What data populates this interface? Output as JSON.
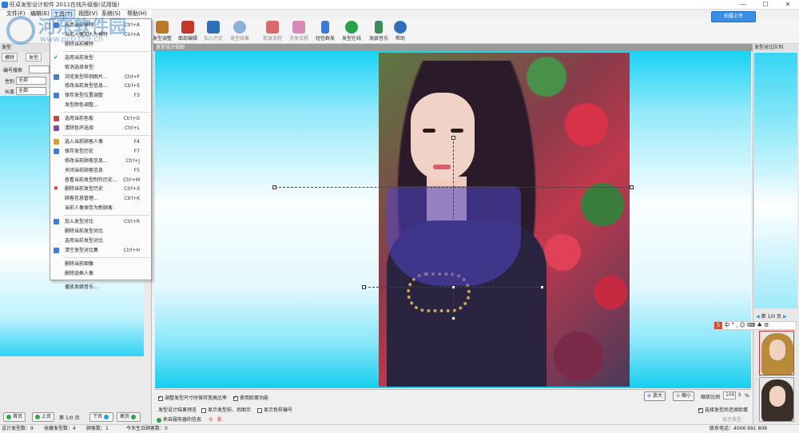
{
  "window": {
    "title": "旺卓发型设计软件 2011在线升级版(试用版)",
    "buttons": {
      "minimize": "—",
      "maximize": "☐",
      "close": "✕"
    }
  },
  "menubar": {
    "items": [
      "文件(F)",
      "编辑(E)",
      "工具(T)",
      "视图(V)",
      "系统(S)",
      "帮助(H)"
    ]
  },
  "toolbar": {
    "items": [
      {
        "label": "发型调整",
        "icon": "hair-adjust-icon",
        "dim": false
      },
      {
        "label": "面部编辑",
        "icon": "face-edit-icon",
        "dim": false
      },
      {
        "label": "加入历史",
        "icon": "add-history-icon",
        "dim": true
      },
      {
        "label": "发型结果",
        "icon": "hair-result-icon",
        "dim": true
      },
      {
        "label": "剪发流程",
        "icon": "cut-flow-icon",
        "dim": true
      },
      {
        "label": "烫发流程",
        "icon": "perm-flow-icon",
        "dim": true
      },
      {
        "label": "短信群发",
        "icon": "sms-icon",
        "dim": false
      },
      {
        "label": "发型在线",
        "icon": "hair-online-icon",
        "dim": false
      },
      {
        "label": "发廊音乐",
        "icon": "music-icon",
        "dim": false
      },
      {
        "label": "帮助",
        "icon": "help-icon",
        "dim": false
      }
    ],
    "upload_label": "拍摄上传"
  },
  "left_panel": {
    "header": "发型",
    "tabs": [
      "模特",
      "发型"
    ],
    "search_label": "编号搜索",
    "filters": [
      {
        "label": "性别",
        "value": "全部"
      },
      {
        "label": "长度",
        "value": "全部"
      }
    ],
    "paging": {
      "first": "首页",
      "prev": "上页",
      "page": "第 1/0 页",
      "next": "下页",
      "last": "尾页"
    }
  },
  "dropdown": {
    "items": [
      {
        "label": "选用当前模特",
        "key": "Ctrl+A",
        "icon": "model-icon",
        "color": "#3d7fd6"
      },
      {
        "label": "当前人像加入为模特",
        "key": "Ctrl+A",
        "icon": "",
        "color": ""
      },
      {
        "label": "删除当前模特",
        "key": "",
        "icon": "",
        "color": ""
      },
      {
        "sep": true
      },
      {
        "label": "选用当前发型",
        "key": "",
        "icon": "check-icon",
        "color": "#2aa04a"
      },
      {
        "label": "取消选择发型",
        "key": "",
        "icon": "",
        "color": ""
      },
      {
        "label": "浏览发型样例图片...",
        "key": "Ctrl+F",
        "icon": "browse-icon",
        "color": "#3d7fd6"
      },
      {
        "label": "修改当前发型信息...",
        "key": "Ctrl+E",
        "icon": "",
        "color": ""
      },
      {
        "label": "保存发型位置调整",
        "key": "F3",
        "icon": "save-icon",
        "color": "#3d7fd6"
      },
      {
        "label": "发型颜色调整...",
        "key": "",
        "icon": "",
        "color": ""
      },
      {
        "sep": true
      },
      {
        "label": "选用当前色板",
        "key": "Ctrl+G",
        "icon": "palette-icon",
        "color": "#c44"
      },
      {
        "label": "清除色环选择",
        "key": "Ctrl+L",
        "icon": "clear-icon",
        "color": "#7a4ab8"
      },
      {
        "sep": true
      },
      {
        "label": "选入当前顾客人像",
        "key": "F4",
        "icon": "customer-icon",
        "color": "#e09a2a"
      },
      {
        "label": "保存发型历史",
        "key": "F7",
        "icon": "history-icon",
        "color": "#3d7fd6"
      },
      {
        "label": "修改当前顾客信息...",
        "key": "Ctrl+J",
        "icon": "",
        "color": ""
      },
      {
        "label": "关闭当前顾客信息",
        "key": "F5",
        "icon": "",
        "color": ""
      },
      {
        "label": "查看当前发型制作历史...",
        "key": "Ctrl+M",
        "icon": "",
        "color": ""
      },
      {
        "label": "删除当前发型历史",
        "key": "Ctrl+X",
        "icon": "delete-icon",
        "color": "#c22"
      },
      {
        "label": "顾客信息管理...",
        "key": "Ctrl+K",
        "icon": "",
        "color": ""
      },
      {
        "label": "当前人像保存为新顾客",
        "key": "",
        "icon": "",
        "color": ""
      },
      {
        "sep": true
      },
      {
        "label": "加入发型对比",
        "key": "Ctrl+R",
        "icon": "compare-icon",
        "color": "#3d7fd6"
      },
      {
        "label": "删除当前发型对比",
        "key": "",
        "icon": "",
        "color": ""
      },
      {
        "label": "选用当前发型对比",
        "key": "",
        "icon": "",
        "color": ""
      },
      {
        "label": "清空发型对比集",
        "key": "Ctrl+H",
        "icon": "clear-compare-icon",
        "color": "#3d7fd6"
      },
      {
        "sep": true
      },
      {
        "label": "删除当前图像",
        "key": "",
        "icon": "",
        "color": ""
      },
      {
        "label": "删除选框人像",
        "key": "",
        "icon": "",
        "color": ""
      },
      {
        "sep": true
      },
      {
        "label": "播放发廊音乐...",
        "key": "",
        "icon": "",
        "color": ""
      }
    ]
  },
  "canvas": {
    "header": "发型设计视图"
  },
  "canvas_bottom": {
    "check1": "调整发型尺寸时保持宽高比率",
    "check2": "使用脸蛋功能",
    "zoom_in": "放大",
    "zoom_out": "缩小",
    "zoom_label": "缩放比例",
    "zoom_value": "100",
    "zoom_unit": "%",
    "preview_label": "发型设计结果预览",
    "check3": "显示发型前、后图示",
    "check4": "显示色样编号",
    "check5": "选择发型后还原脸蛋",
    "message_label": "来自服务器的信息",
    "message_count": "0",
    "message_unit": "条",
    "show_hair": "显示发型"
  },
  "right_panel": {
    "header": "发型对比队列",
    "page": "第 1/0 页"
  },
  "ime": {
    "text": "中 ° , ☺ ⌨ ♣ ⚙"
  },
  "statusbar": {
    "designs": "设计发型数：9",
    "collected": "收藏发型数：4",
    "customers": "顾客数：1",
    "today": "今天生日顾客数：0",
    "contact": "联系电话：4006 991 808"
  },
  "watermark": {
    "text": "河东软件园",
    "url": "www.pc0359.cn"
  },
  "colors": {
    "accent": "#3a8ee6",
    "canvas_cyan": "#19d2f2",
    "overlay": "#5046c8"
  }
}
